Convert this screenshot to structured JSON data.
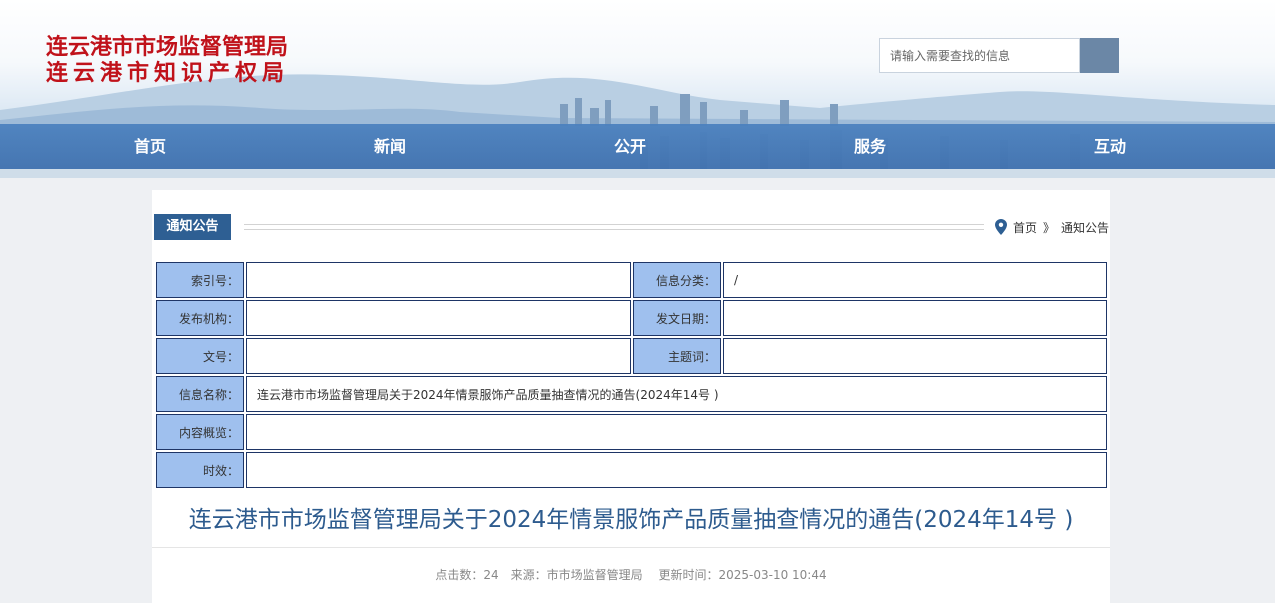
{
  "header": {
    "org_name_1": "连云港市市场监督管理局",
    "org_name_2": "连云港市知识产权局",
    "search_placeholder": "请输入需要查找的信息"
  },
  "nav": [
    {
      "label": "首页"
    },
    {
      "label": "新闻"
    },
    {
      "label": "公开"
    },
    {
      "label": "服务"
    },
    {
      "label": "互动"
    }
  ],
  "category": "通知公告",
  "breadcrumb": {
    "home": "首页",
    "sep": "》",
    "current": "通知公告"
  },
  "info": {
    "index_label": "索引号：",
    "index_value": "",
    "class_label": "信息分类：",
    "class_value": "/",
    "org_label": "发布机构：",
    "org_value": "",
    "date_label": "发文日期：",
    "date_value": "",
    "docno_label": "文号：",
    "docno_value": "",
    "topic_label": "主题词：",
    "topic_value": "",
    "name_label": "信息名称：",
    "name_value": "连云港市市场监督管理局关于2024年情景服饰产品质量抽查情况的通告(2024年14号 )",
    "summary_label": "内容概览：",
    "summary_value": "",
    "validity_label": "时效：",
    "validity_value": ""
  },
  "article": {
    "title": "连云港市市场监督管理局关于2024年情景服饰产品质量抽查情况的通告(2024年14号 )",
    "clicks": "点击数：24",
    "source": "来源：市市场监督管理局",
    "updated": "更新时间：2025-03-10 10:44"
  },
  "colors": {
    "brand_red": "#c0121a",
    "nav_blue": "#3e74b4",
    "label_bg": "#9fc0ee",
    "title_blue": "#2d5b8e"
  },
  "icons": {
    "breadcrumb": "location-pin-icon"
  }
}
